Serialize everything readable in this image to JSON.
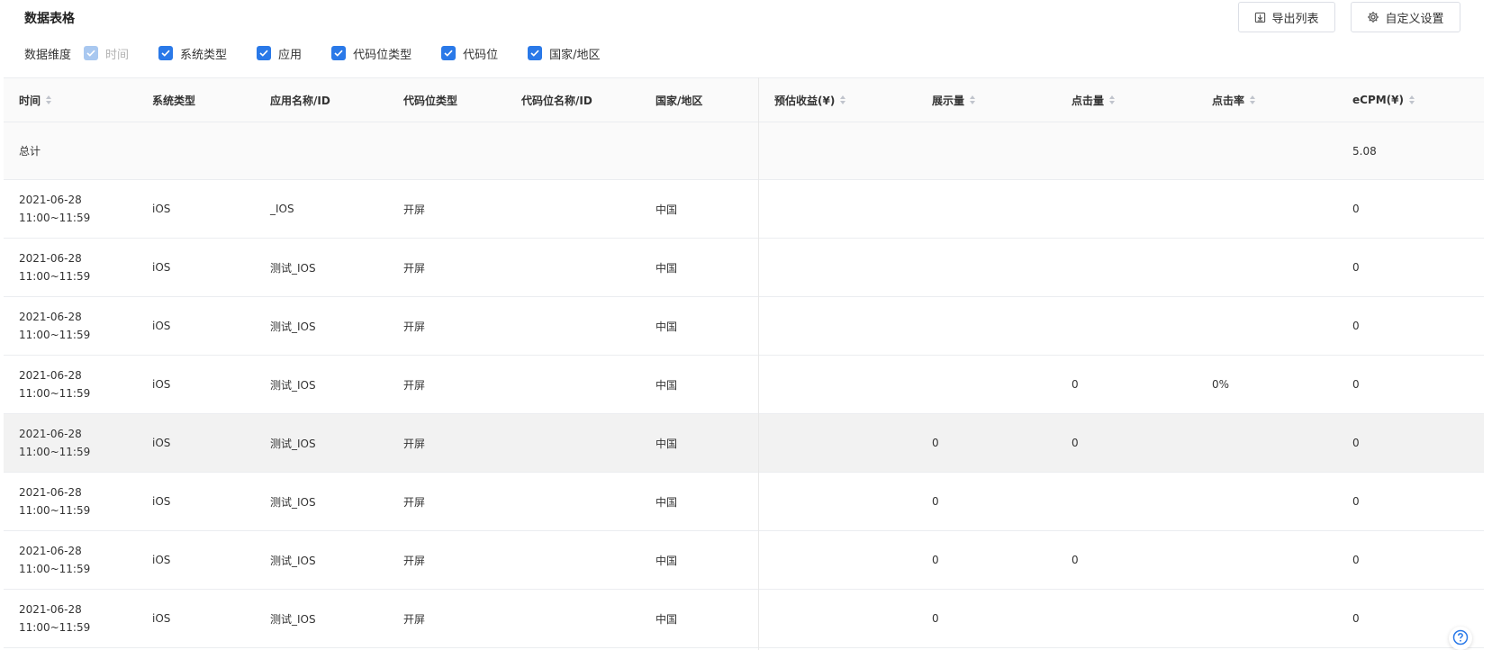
{
  "section_title": "数据表格",
  "toolbar": {
    "export_label": "导出列表",
    "custom_label": "自定义设置",
    "export_icon": "download-icon",
    "custom_icon": "gear-icon"
  },
  "dimensions": {
    "label": "数据维度",
    "options": [
      {
        "label": "时间",
        "checked": true,
        "disabled": true
      },
      {
        "label": "系统类型",
        "checked": true,
        "disabled": false
      },
      {
        "label": "应用",
        "checked": true,
        "disabled": false
      },
      {
        "label": "代码位类型",
        "checked": true,
        "disabled": false
      },
      {
        "label": "代码位",
        "checked": true,
        "disabled": false
      },
      {
        "label": "国家/地区",
        "checked": true,
        "disabled": false
      }
    ]
  },
  "table": {
    "columns": [
      "时间",
      "系统类型",
      "应用名称/ID",
      "代码位类型",
      "代码位名称/ID",
      "国家/地区",
      "预估收益(¥)",
      "展示量",
      "点击量",
      "点击率",
      "eCPM(¥)"
    ],
    "total": {
      "label": "总计",
      "ecpm": "5.08"
    },
    "rows": [
      {
        "date": "2021-06-28",
        "time": "11:00~11:59",
        "os": "iOS",
        "app": "_IOS",
        "slot_type": "开屏",
        "slot": "",
        "country": "中国",
        "revenue": "",
        "impressions": "",
        "clicks": "",
        "ctr": "",
        "ecpm": "0"
      },
      {
        "date": "2021-06-28",
        "time": "11:00~11:59",
        "os": "iOS",
        "app": "测试_IOS",
        "slot_type": "开屏",
        "slot": "",
        "country": "中国",
        "revenue": "",
        "impressions": "",
        "clicks": "",
        "ctr": "",
        "ecpm": "0"
      },
      {
        "date": "2021-06-28",
        "time": "11:00~11:59",
        "os": "iOS",
        "app": "测试_IOS",
        "slot_type": "开屏",
        "slot": "",
        "country": "中国",
        "revenue": "",
        "impressions": "",
        "clicks": "",
        "ctr": "",
        "ecpm": "0"
      },
      {
        "date": "2021-06-28",
        "time": "11:00~11:59",
        "os": "iOS",
        "app": "测试_IOS",
        "slot_type": "开屏",
        "slot": "",
        "country": "中国",
        "revenue": "",
        "impressions": "",
        "clicks": "0",
        "ctr": "0%",
        "ecpm": "0"
      },
      {
        "date": "2021-06-28",
        "time": "11:00~11:59",
        "os": "iOS",
        "app": "测试_IOS",
        "slot_type": "开屏",
        "slot": "",
        "country": "中国",
        "revenue": "",
        "impressions": "0",
        "clicks": "0",
        "ctr": "",
        "ecpm": "0"
      },
      {
        "date": "2021-06-28",
        "time": "11:00~11:59",
        "os": "iOS",
        "app": "测试_IOS",
        "slot_type": "开屏",
        "slot": "",
        "country": "中国",
        "revenue": "",
        "impressions": "0",
        "clicks": "",
        "ctr": "",
        "ecpm": "0"
      },
      {
        "date": "2021-06-28",
        "time": "11:00~11:59",
        "os": "iOS",
        "app": "测试_IOS",
        "slot_type": "开屏",
        "slot": "",
        "country": "中国",
        "revenue": "",
        "impressions": "0",
        "clicks": "0",
        "ctr": "",
        "ecpm": "0"
      },
      {
        "date": "2021-06-28",
        "time": "11:00~11:59",
        "os": "iOS",
        "app": "测试_IOS",
        "slot_type": "开屏",
        "slot": "",
        "country": "中国",
        "revenue": "",
        "impressions": "0",
        "clicks": "",
        "ctr": "",
        "ecpm": "0"
      }
    ]
  },
  "help_icon": "question-icon"
}
